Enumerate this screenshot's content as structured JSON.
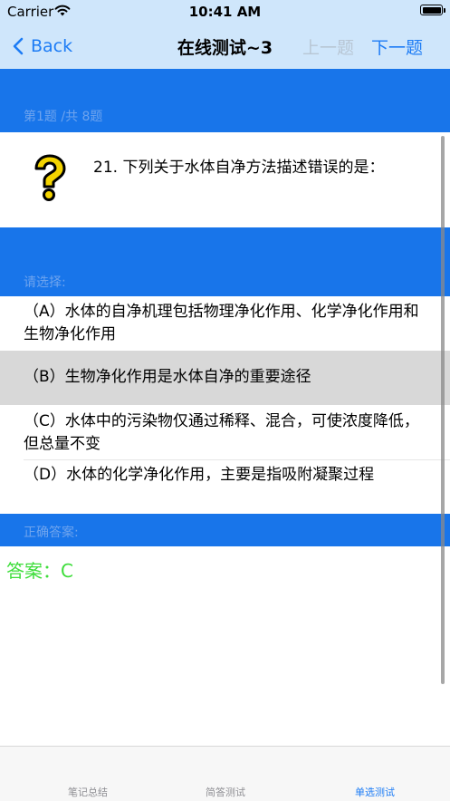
{
  "status": {
    "carrier": "Carrier",
    "time": "10:41 AM"
  },
  "nav": {
    "back_label": "Back",
    "title": "在线测试~3",
    "prev_label": "上一题",
    "next_label": "下一题"
  },
  "progress_label": "第1题 /共 8题",
  "question": {
    "icon": "question-mark-icon",
    "text": "21. 下列关于水体自净方法描述错误的是："
  },
  "choose_label": "请选择:",
  "options": [
    {
      "label": "（A）水体的自净机理包括物理净化作用、化学净化作用和生物净化作用",
      "selected": false
    },
    {
      "label": "（B）生物净化作用是水体自净的重要途径",
      "selected": true
    },
    {
      "label": "（C）水体中的污染物仅通过稀释、混合，可使浓度降低，但总量不变",
      "selected": false
    },
    {
      "label": "（D）水体的化学净化作用，主要是指吸附凝聚过程",
      "selected": false
    }
  ],
  "correct_label": "正确答案:",
  "answer": "答案：C",
  "tabs": [
    {
      "label": "笔记总结",
      "active": false
    },
    {
      "label": "简答测试",
      "active": false
    },
    {
      "label": "单选测试",
      "active": true
    }
  ],
  "colors": {
    "accent": "#1d7cf5",
    "band": "#1875ea",
    "nav_bg": "#cfe6fb",
    "answer": "#3ddd3a",
    "selected_bg": "#d8d8d8"
  }
}
